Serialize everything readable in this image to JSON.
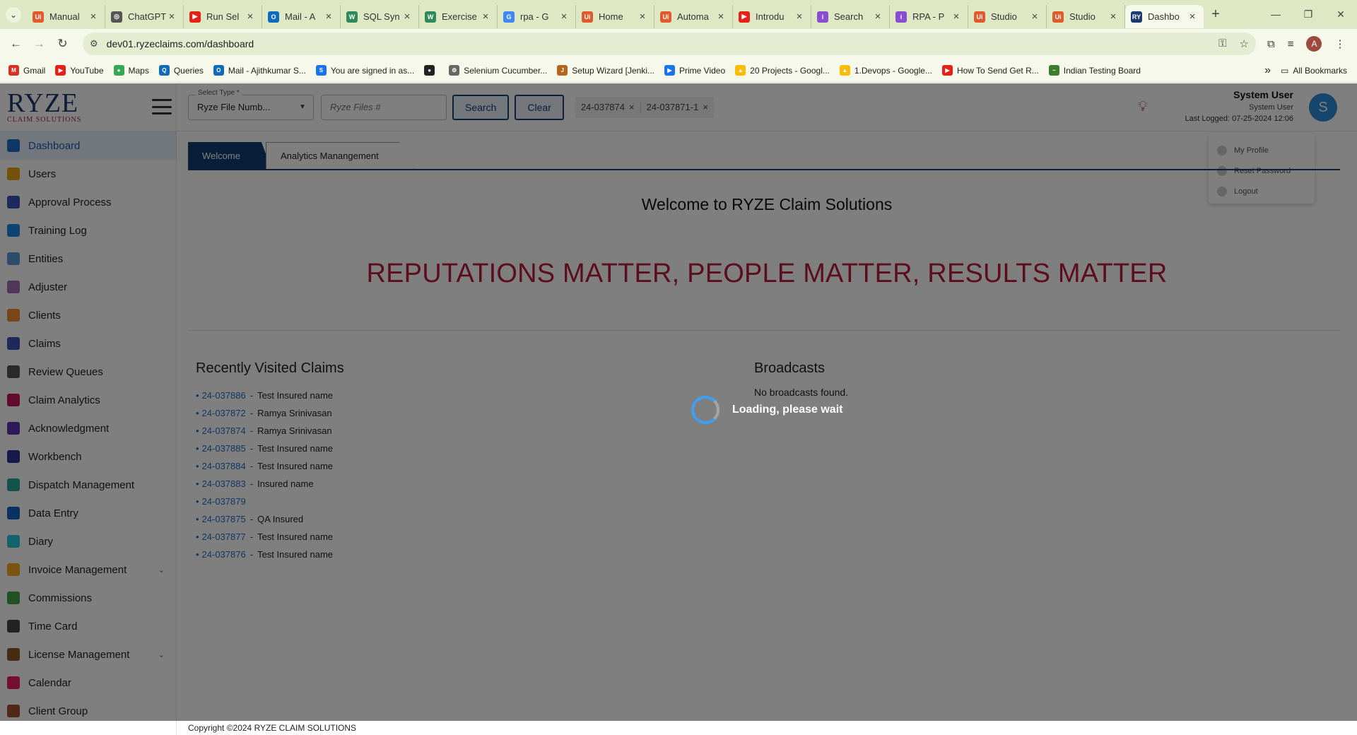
{
  "browser": {
    "tabs": [
      {
        "title": "Manual",
        "favicon_color": "#e05a2b",
        "glyph": "Ui"
      },
      {
        "title": "ChatGPT",
        "favicon_color": "#555555",
        "glyph": "◎"
      },
      {
        "title": "Run Sel",
        "favicon_color": "#e62117",
        "glyph": "▶"
      },
      {
        "title": "Mail - A",
        "favicon_color": "#0f6cbd",
        "glyph": "O"
      },
      {
        "title": "SQL Syn",
        "favicon_color": "#2e8b57",
        "glyph": "W"
      },
      {
        "title": "Exercise",
        "favicon_color": "#2e8b57",
        "glyph": "W"
      },
      {
        "title": "rpa - G",
        "favicon_color": "#4285f4",
        "glyph": "G"
      },
      {
        "title": "Home",
        "favicon_color": "#e05a2b",
        "glyph": "Ui"
      },
      {
        "title": "Automa",
        "favicon_color": "#e05a2b",
        "glyph": "Ui"
      },
      {
        "title": "Introdu",
        "favicon_color": "#e62117",
        "glyph": "▶"
      },
      {
        "title": "Search",
        "favicon_color": "#8a4dd1",
        "glyph": "i"
      },
      {
        "title": "RPA - P",
        "favicon_color": "#8a4dd1",
        "glyph": "i"
      },
      {
        "title": "Studio",
        "favicon_color": "#e05a2b",
        "glyph": "Ui"
      },
      {
        "title": "Studio",
        "favicon_color": "#e05a2b",
        "glyph": "Ui"
      },
      {
        "title": "Dashbo",
        "favicon_color": "#1f3a6f",
        "glyph": "RY",
        "active": true
      }
    ],
    "url": "dev01.ryzeclaims.com/dashboard",
    "bookmarks": [
      {
        "label": "Gmail",
        "color": "#d93025",
        "glyph": "M"
      },
      {
        "label": "YouTube",
        "color": "#e62117",
        "glyph": "▶"
      },
      {
        "label": "Maps",
        "color": "#34a853",
        "glyph": "●"
      },
      {
        "label": "Queries",
        "color": "#0f6cbd",
        "glyph": "Q"
      },
      {
        "label": "Mail - Ajithkumar S...",
        "color": "#0f6cbd",
        "glyph": "O"
      },
      {
        "label": "You are signed in as...",
        "color": "#1a73e8",
        "glyph": "S"
      },
      {
        "label": "",
        "color": "#222222",
        "glyph": "●"
      },
      {
        "label": "Selenium Cucumber...",
        "color": "#666666",
        "glyph": "⚙"
      },
      {
        "label": "Setup Wizard [Jenki...",
        "color": "#b5651d",
        "glyph": "J"
      },
      {
        "label": "Prime Video",
        "color": "#1a73e8",
        "glyph": "▶"
      },
      {
        "label": "20 Projects - Googl...",
        "color": "#fbbc05",
        "glyph": "▲"
      },
      {
        "label": "1.Devops - Google...",
        "color": "#fbbc05",
        "glyph": "▲"
      },
      {
        "label": "How To Send Get R...",
        "color": "#e62117",
        "glyph": "▶"
      },
      {
        "label": "Indian Testing Board",
        "color": "#3a7d2c",
        "glyph": "~"
      }
    ],
    "all_bookmarks": "All Bookmarks"
  },
  "sidebar": {
    "logo": "RYZE",
    "logo_sub": "CLAIM SOLUTIONS",
    "items": [
      {
        "label": "Dashboard",
        "color": "#1f6fc6",
        "active": true
      },
      {
        "label": "Users",
        "color": "#e8a317"
      },
      {
        "label": "Approval Process",
        "color": "#3f51b5"
      },
      {
        "label": "Training Log",
        "color": "#1e88e5"
      },
      {
        "label": "Entities",
        "color": "#5c9bd6"
      },
      {
        "label": "Adjuster",
        "color": "#9c6fb1"
      },
      {
        "label": "Clients",
        "color": "#f08c2e"
      },
      {
        "label": "Claims",
        "color": "#3f51b5"
      },
      {
        "label": "Review Queues",
        "color": "#555555"
      },
      {
        "label": "Claim Analytics",
        "color": "#c2185b"
      },
      {
        "label": "Acknowledgment",
        "color": "#5e35b1"
      },
      {
        "label": "Workbench",
        "color": "#283593"
      },
      {
        "label": "Dispatch Management",
        "color": "#26a69a"
      },
      {
        "label": "Data Entry",
        "color": "#1565c0"
      },
      {
        "label": "Diary",
        "color": "#26c6da"
      },
      {
        "label": "Invoice Management",
        "color": "#f9a825",
        "chevron": true
      },
      {
        "label": "Commissions",
        "color": "#43a047"
      },
      {
        "label": "Time Card",
        "color": "#444444"
      },
      {
        "label": "License Management",
        "color": "#8d5524",
        "chevron": true
      },
      {
        "label": "Calendar",
        "color": "#e91e63"
      },
      {
        "label": "Client Group",
        "color": "#a0522d"
      }
    ]
  },
  "topbar": {
    "select_label": "Select Type *",
    "select_value": "Ryze File Numb...",
    "files_placeholder": "Ryze Files #",
    "search_label": "Search",
    "clear_label": "Clear",
    "chips": [
      "24-037874",
      "24-037871-1"
    ],
    "user_name": "System User",
    "user_role": "System User",
    "last_logged": "Last Logged: 07-25-2024 12:06",
    "avatar_letter": "S",
    "menu": [
      "My Profile",
      "Reset Password",
      "Logout"
    ]
  },
  "tabs": {
    "welcome": "Welcome",
    "analytics": "Analytics Manangement"
  },
  "content": {
    "welcome_title": "Welcome to RYZE Claim Solutions",
    "motto": "REPUTATIONS MATTER, PEOPLE MATTER, RESULTS MATTER",
    "recent_title": "Recently Visited Claims",
    "claims": [
      {
        "num": "24-037886",
        "name": "Test Insured name"
      },
      {
        "num": "24-037872",
        "name": "Ramya Srinivasan"
      },
      {
        "num": "24-037874",
        "name": "Ramya Srinivasan"
      },
      {
        "num": "24-037885",
        "name": "Test Insured name"
      },
      {
        "num": "24-037884",
        "name": "Test Insured name"
      },
      {
        "num": "24-037883",
        "name": "Insured name"
      },
      {
        "num": "24-037879",
        "name": ""
      },
      {
        "num": "24-037875",
        "name": "QA Insured"
      },
      {
        "num": "24-037877",
        "name": "Test Insured name"
      },
      {
        "num": "24-037876",
        "name": "Test Insured name"
      }
    ],
    "broadcast_title": "Broadcasts",
    "broadcast_empty": "No broadcasts found."
  },
  "footer": "Copyright ©2024 RYZE CLAIM SOLUTIONS",
  "loading_text": "Loading, please wait"
}
